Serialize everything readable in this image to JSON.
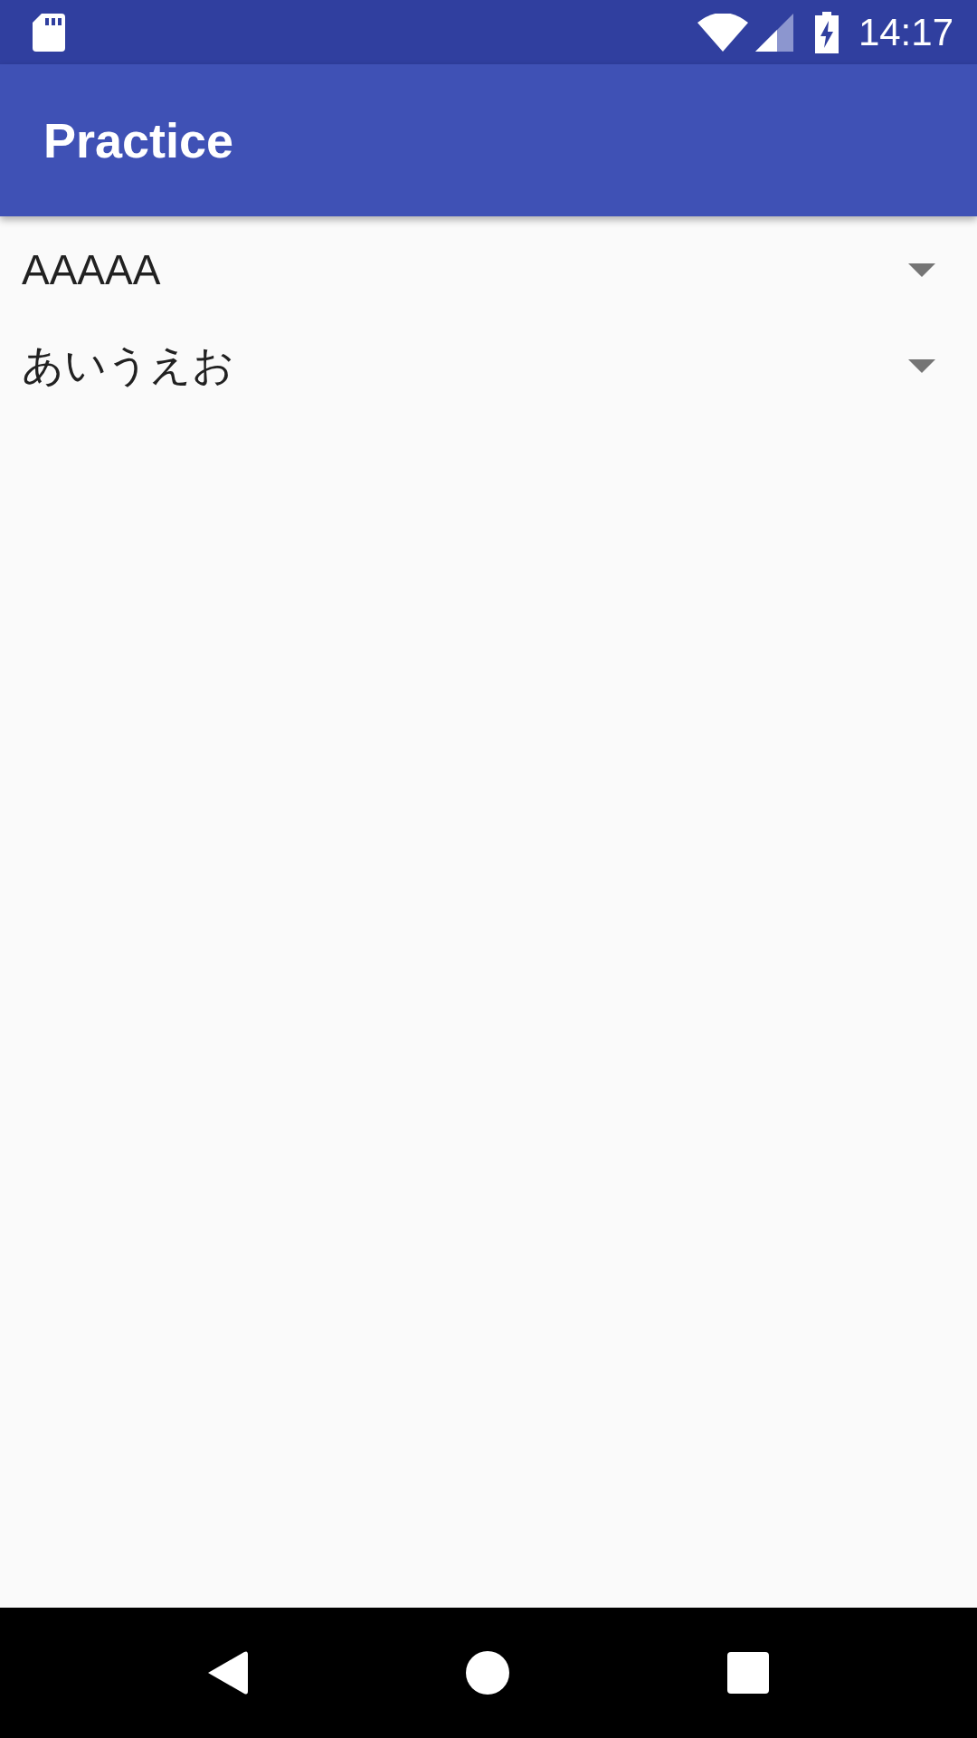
{
  "status_bar": {
    "time": "14:17"
  },
  "app_bar": {
    "title": "Practice"
  },
  "spinners": [
    {
      "value": "AAAAA"
    },
    {
      "value": "あいうえお"
    }
  ]
}
